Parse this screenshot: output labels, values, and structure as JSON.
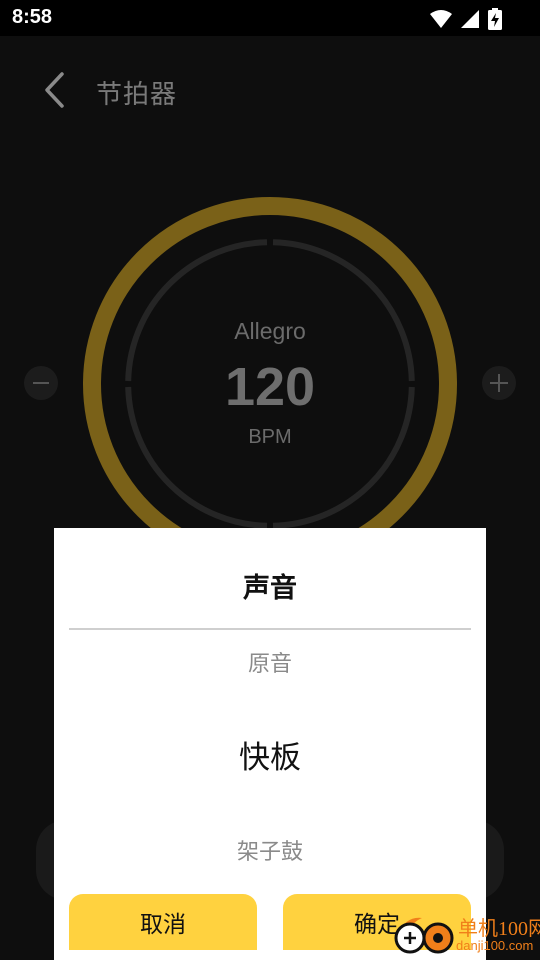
{
  "status_bar": {
    "time": "8:58"
  },
  "header": {
    "title": "节拍器"
  },
  "metronome": {
    "tempo_name": "Allegro",
    "bpm": "120",
    "unit": "BPM"
  },
  "dialog": {
    "title": "声音",
    "options": {
      "prev": "原音",
      "selected": "快板",
      "next": "架子鼓"
    },
    "cancel_label": "取消",
    "confirm_label": "确定"
  },
  "colors": {
    "ring": "#7a6118",
    "dialog_button": "#ffd23f",
    "background": "#0e0e0e"
  },
  "watermark": {
    "line1": "单机100网",
    "line2": "danji100.com"
  }
}
